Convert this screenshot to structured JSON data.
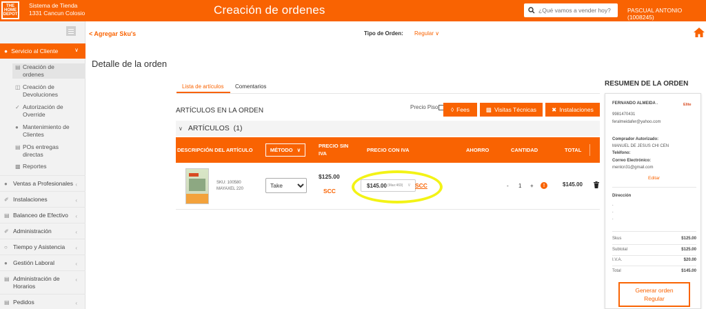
{
  "header": {
    "logo_text": "THE HOME DEPOT",
    "store_line1": "Sistema de Tienda",
    "store_line2": "1331 Cancun Colosio",
    "title": "Creación de ordenes",
    "search_placeholder": "¿Qué vamos a vender hoy?",
    "user": "PASCUAL ANTONIO (1008245)",
    "brand_color": "#f96302"
  },
  "sidebar": {
    "active_section": "Servicio al Cliente",
    "sub_items": [
      {
        "label_1": "Creación de",
        "label_2": "ordenes",
        "icon": "list-icon"
      },
      {
        "label_1": "Creación de",
        "label_2": "Devoluciones",
        "icon": "returns-icon"
      },
      {
        "label_1": "Autorización de",
        "label_2": "Override",
        "icon": "check-icon"
      },
      {
        "label_1": "Mantenimiento de",
        "label_2": "Clientes",
        "icon": "user-icon"
      },
      {
        "label_1": "POs entregas",
        "label_2": "directas",
        "icon": "document-icon"
      },
      {
        "label_1": "Reportes",
        "label_2": "",
        "icon": "report-icon"
      }
    ],
    "items": [
      {
        "label_1": "Ventas a Profesionales",
        "label_2": "",
        "icon": "people-icon"
      },
      {
        "label_1": "Instalaciones",
        "label_2": "",
        "icon": "wrench-icon"
      },
      {
        "label_1": "Balanceo de Efectivo",
        "label_2": "",
        "icon": "cash-icon"
      },
      {
        "label_1": "Administración",
        "label_2": "",
        "icon": "tools-icon"
      },
      {
        "label_1": "Tiempo y Asistencia",
        "label_2": "",
        "icon": "clock-icon"
      },
      {
        "label_1": "Gestión Laboral",
        "label_2": "",
        "icon": "group-icon"
      },
      {
        "label_1": "Administración de",
        "label_2": "Horarios",
        "icon": "calendar-icon"
      },
      {
        "label_1": "Pedidos",
        "label_2": "",
        "icon": "box-icon"
      }
    ]
  },
  "toolbar": {
    "back_label": "< Agregar Sku's",
    "order_type_label": "Tipo de Orden:",
    "order_type_value": "Regular"
  },
  "main": {
    "page_title": "Detalle de la orden",
    "tabs": [
      "Lista de artículos",
      "Comentarios"
    ],
    "items_heading": "ARTÍCULOS EN LA ORDEN",
    "precio_piso_label": "Precio Piso",
    "buttons": {
      "fees": "Fees",
      "visitas": "Visitas Técnicas",
      "instalaciones": "Instalaciones"
    },
    "section_title": "ARTÍCULOS",
    "section_count": "(1)",
    "columns": {
      "descripcion": "DESCRIPCIÓN DEL ARTÍCULO",
      "metodo": "MÉTODO",
      "precio_sin_1": "PRECIO SIN",
      "precio_sin_2": "IVA",
      "precio_con": "PRECIO CON IVA",
      "ahorro": "AHORRO",
      "cantidad": "CANTIDAD",
      "total": "TOTAL"
    },
    "row": {
      "sku": "SKU: 100580",
      "name": "MAYAXEL 220",
      "method_options": [
        "Take"
      ],
      "method_selected": "Take",
      "precio_sin_iva": "$125.00",
      "scc": "SCC",
      "precio_con_iva": "$145.00",
      "precio_max": "(Max:469)",
      "scc_link": "SCC",
      "qty_minus": "-",
      "qty_value": "1",
      "qty_plus": "+",
      "total": "$145.00"
    },
    "highlight_color": "#f3f316"
  },
  "summary": {
    "title": "RESUMEN DE LA ORDEN",
    "customer_name": "FERNANDO ALMEIDA .",
    "customer_tag": "Elite",
    "phone": "9981470431",
    "email": "feralmeidafer@yahoo.com",
    "comprador_label": "Comprador Autorizado:",
    "comprador_value": "MANUEL DE JESUS CHI CEN",
    "telefono_label": "Teléfono:",
    "correo_label": "Correo Electrónico:",
    "correo_value": "menlcn31@gmail.com",
    "edit_link": "Editar",
    "direccion_label": "Dirección",
    "direccion_lines": [
      ".",
      ".",
      "."
    ],
    "rows": [
      {
        "label": "Skus",
        "value": "$125.00"
      },
      {
        "label": "Subtotal",
        "value": "$125.00"
      },
      {
        "label": "I.V.A.",
        "value": "$20.00"
      },
      {
        "label": "Total",
        "value": "$145.00"
      }
    ],
    "generate_line1": "Generar orden",
    "generate_line2": "Regular"
  }
}
